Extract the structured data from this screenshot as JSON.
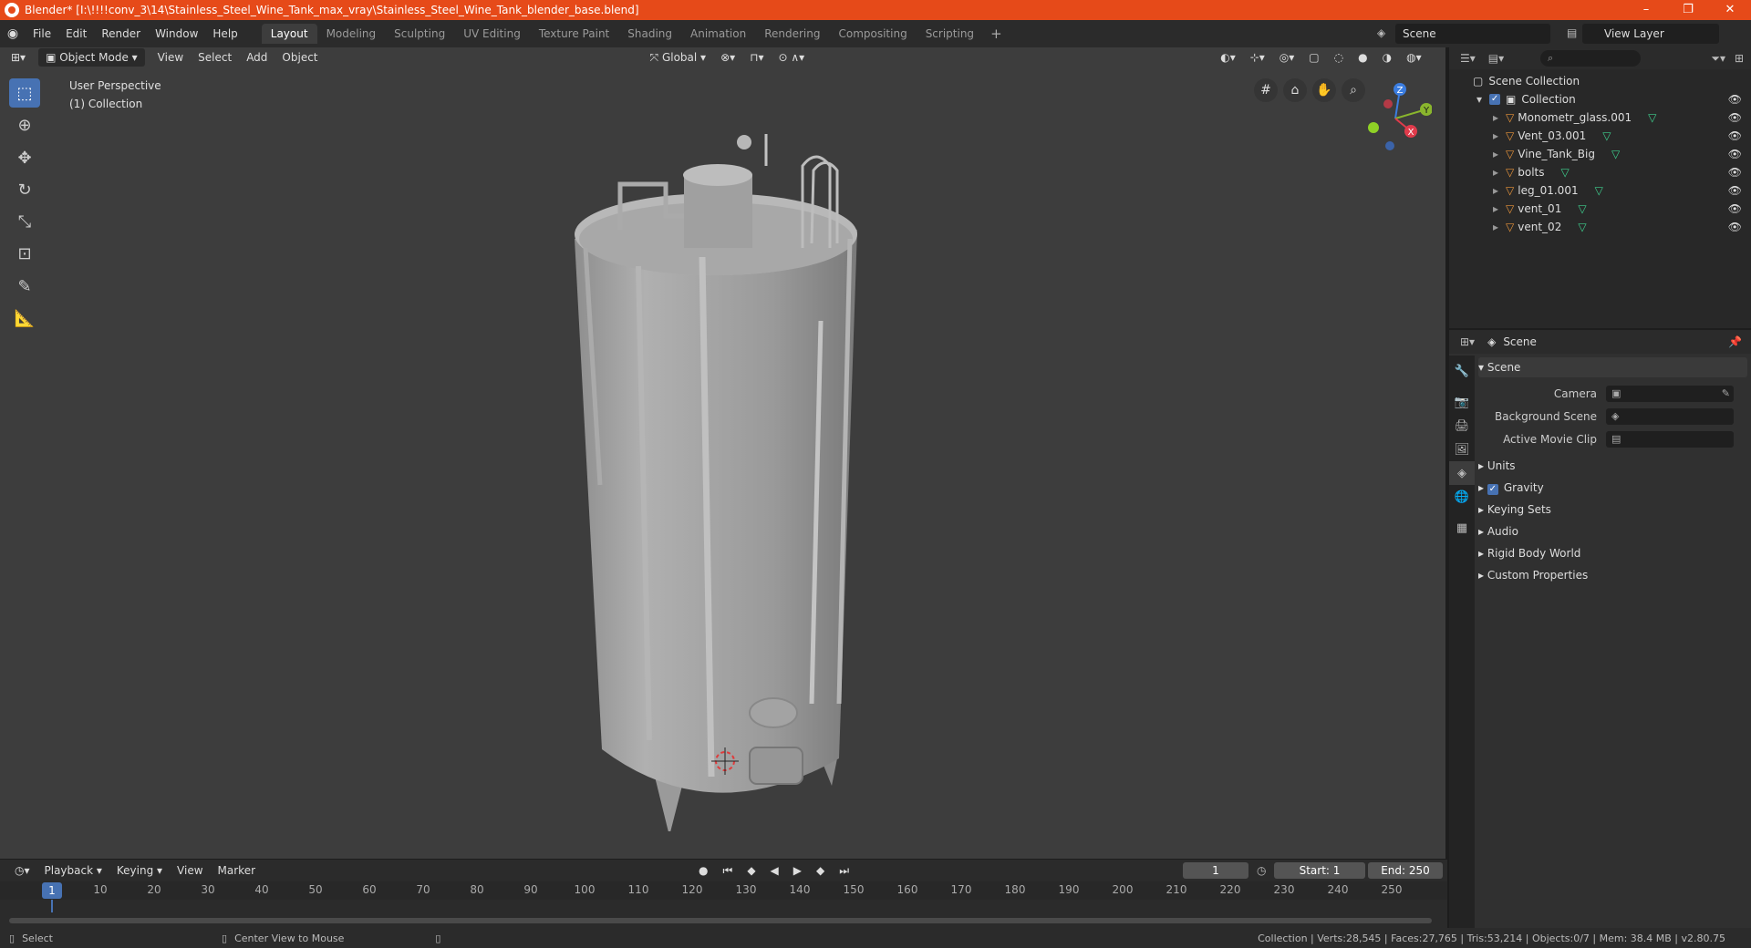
{
  "window": {
    "title": "Blender* [I:\\!!!!conv_3\\14\\Stainless_Steel_Wine_Tank_max_vray\\Stainless_Steel_Wine_Tank_blender_base.blend]",
    "minimize": "–",
    "maximize": "❐",
    "close": "✕"
  },
  "menu": [
    "File",
    "Edit",
    "Render",
    "Window",
    "Help"
  ],
  "workspaces": [
    "Layout",
    "Modeling",
    "Sculpting",
    "UV Editing",
    "Texture Paint",
    "Shading",
    "Animation",
    "Rendering",
    "Compositing",
    "Scripting"
  ],
  "workspace_add": "+",
  "scene_name": "Scene",
  "view_layer": "View Layer",
  "viewport": {
    "mode": "Object Mode",
    "menus": [
      "View",
      "Select",
      "Add",
      "Object"
    ],
    "orientation": "Global",
    "perspective": "User Perspective",
    "collection": "(1) Collection"
  },
  "gizmo": {
    "x": "X",
    "y": "Y",
    "z": "Z"
  },
  "outliner": {
    "root": "Scene Collection",
    "collection": "Collection",
    "objects": [
      "Monometr_glass.001",
      "Vent_03.001",
      "Vine_Tank_Big",
      "bolts",
      "leg_01.001",
      "vent_01",
      "vent_02"
    ]
  },
  "properties": {
    "header": "Scene",
    "section": "Scene",
    "rows": [
      {
        "label": "Camera"
      },
      {
        "label": "Background Scene"
      },
      {
        "label": "Active Movie Clip"
      }
    ],
    "subsections": [
      "Units",
      "Gravity",
      "Keying Sets",
      "Audio",
      "Rigid Body World",
      "Custom Properties"
    ]
  },
  "timeline": {
    "menus": [
      "Playback",
      "Keying",
      "View",
      "Marker"
    ],
    "current_frame": "1",
    "start_label": "Start:",
    "start": "1",
    "end_label": "End:",
    "end": "250",
    "ticks": [
      "10",
      "20",
      "30",
      "40",
      "50",
      "60",
      "70",
      "80",
      "90",
      "100",
      "110",
      "120",
      "130",
      "140",
      "150",
      "160",
      "170",
      "180",
      "190",
      "200",
      "210",
      "220",
      "230",
      "240",
      "250"
    ]
  },
  "statusbar": {
    "left": "Select",
    "middle": "Center View to Mouse",
    "stats": "Collection | Verts:28,545 | Faces:27,765 | Tris:53,214 | Objects:0/7 | Mem: 38.4 MB | v2.80.75"
  }
}
